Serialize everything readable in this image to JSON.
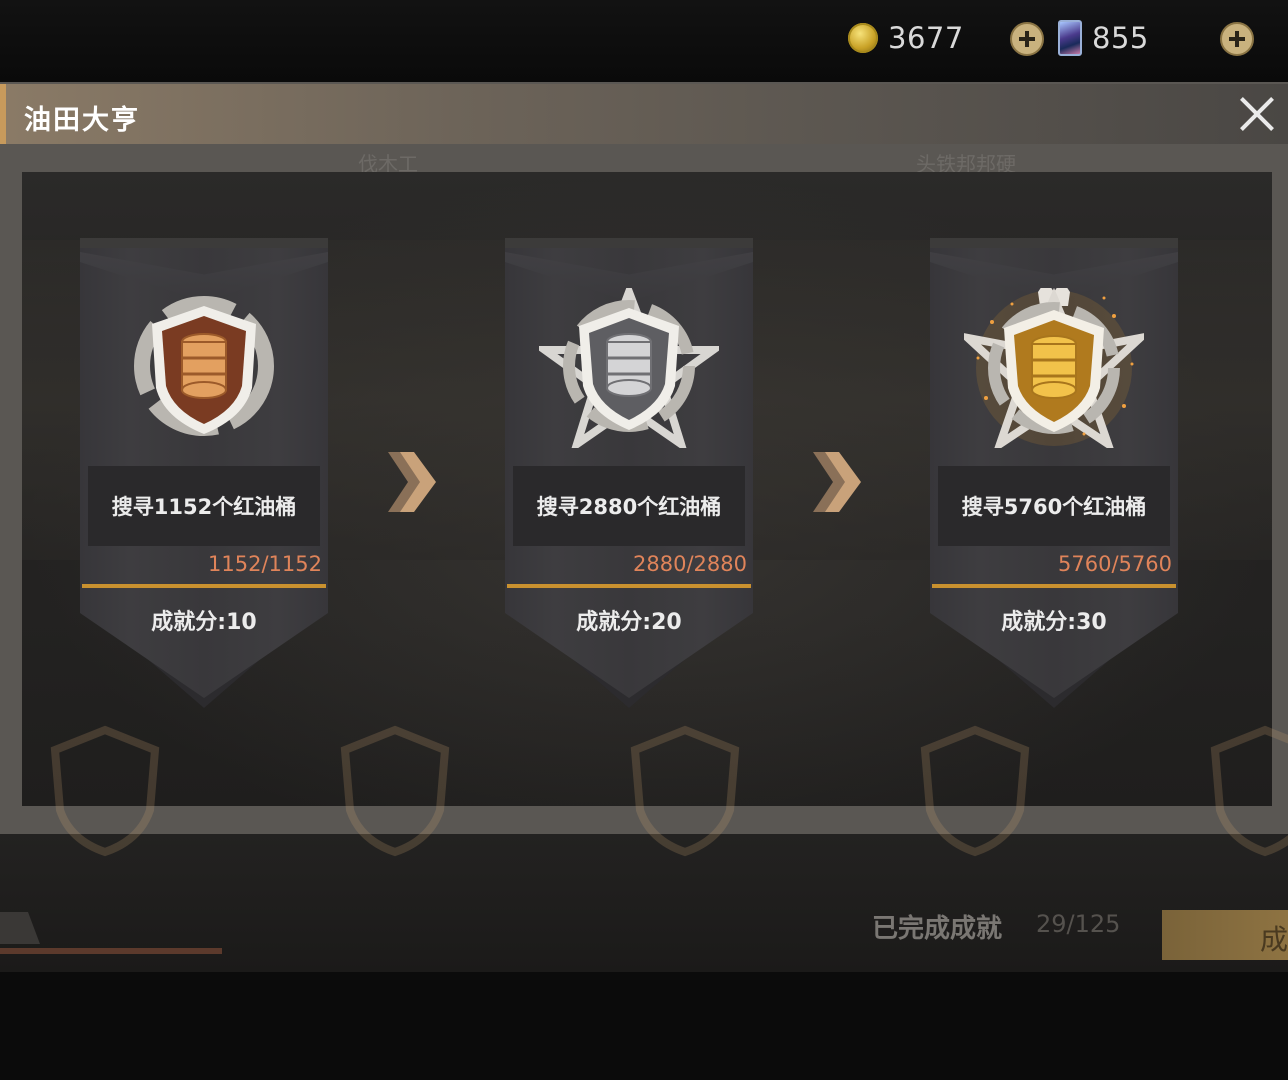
{
  "currency": {
    "gold": "3677",
    "cards": "855",
    "gold_icon": "gold-coin-icon",
    "card_icon": "card-icon",
    "plus_icon": "plus-icon"
  },
  "dialog": {
    "title": "油田大亨",
    "close_icon": "close-icon",
    "background_tabs": [
      "伐木工",
      "头铁邦邦硬"
    ]
  },
  "achievements": [
    {
      "tier": "bronze",
      "description": "搜寻1152个红油桶",
      "progress": "1152/1152",
      "score": "成就分:10"
    },
    {
      "tier": "silver",
      "description": "搜寻2880个红油桶",
      "progress": "2880/2880",
      "score": "成就分:20"
    },
    {
      "tier": "gold",
      "description": "搜寻5760个红油桶",
      "progress": "5760/5760",
      "score": "成就分:30"
    }
  ],
  "footer": {
    "completed_label": "已完成成就",
    "completed_count": "29/125",
    "button_label": "成"
  },
  "colors": {
    "bronze": "#8a4a2e",
    "silver": "#9a9a9c",
    "gold": "#d8a83a",
    "progress_text": "#e0845a",
    "progress_bar": "#c9912f",
    "arrow": "#b7926a"
  }
}
